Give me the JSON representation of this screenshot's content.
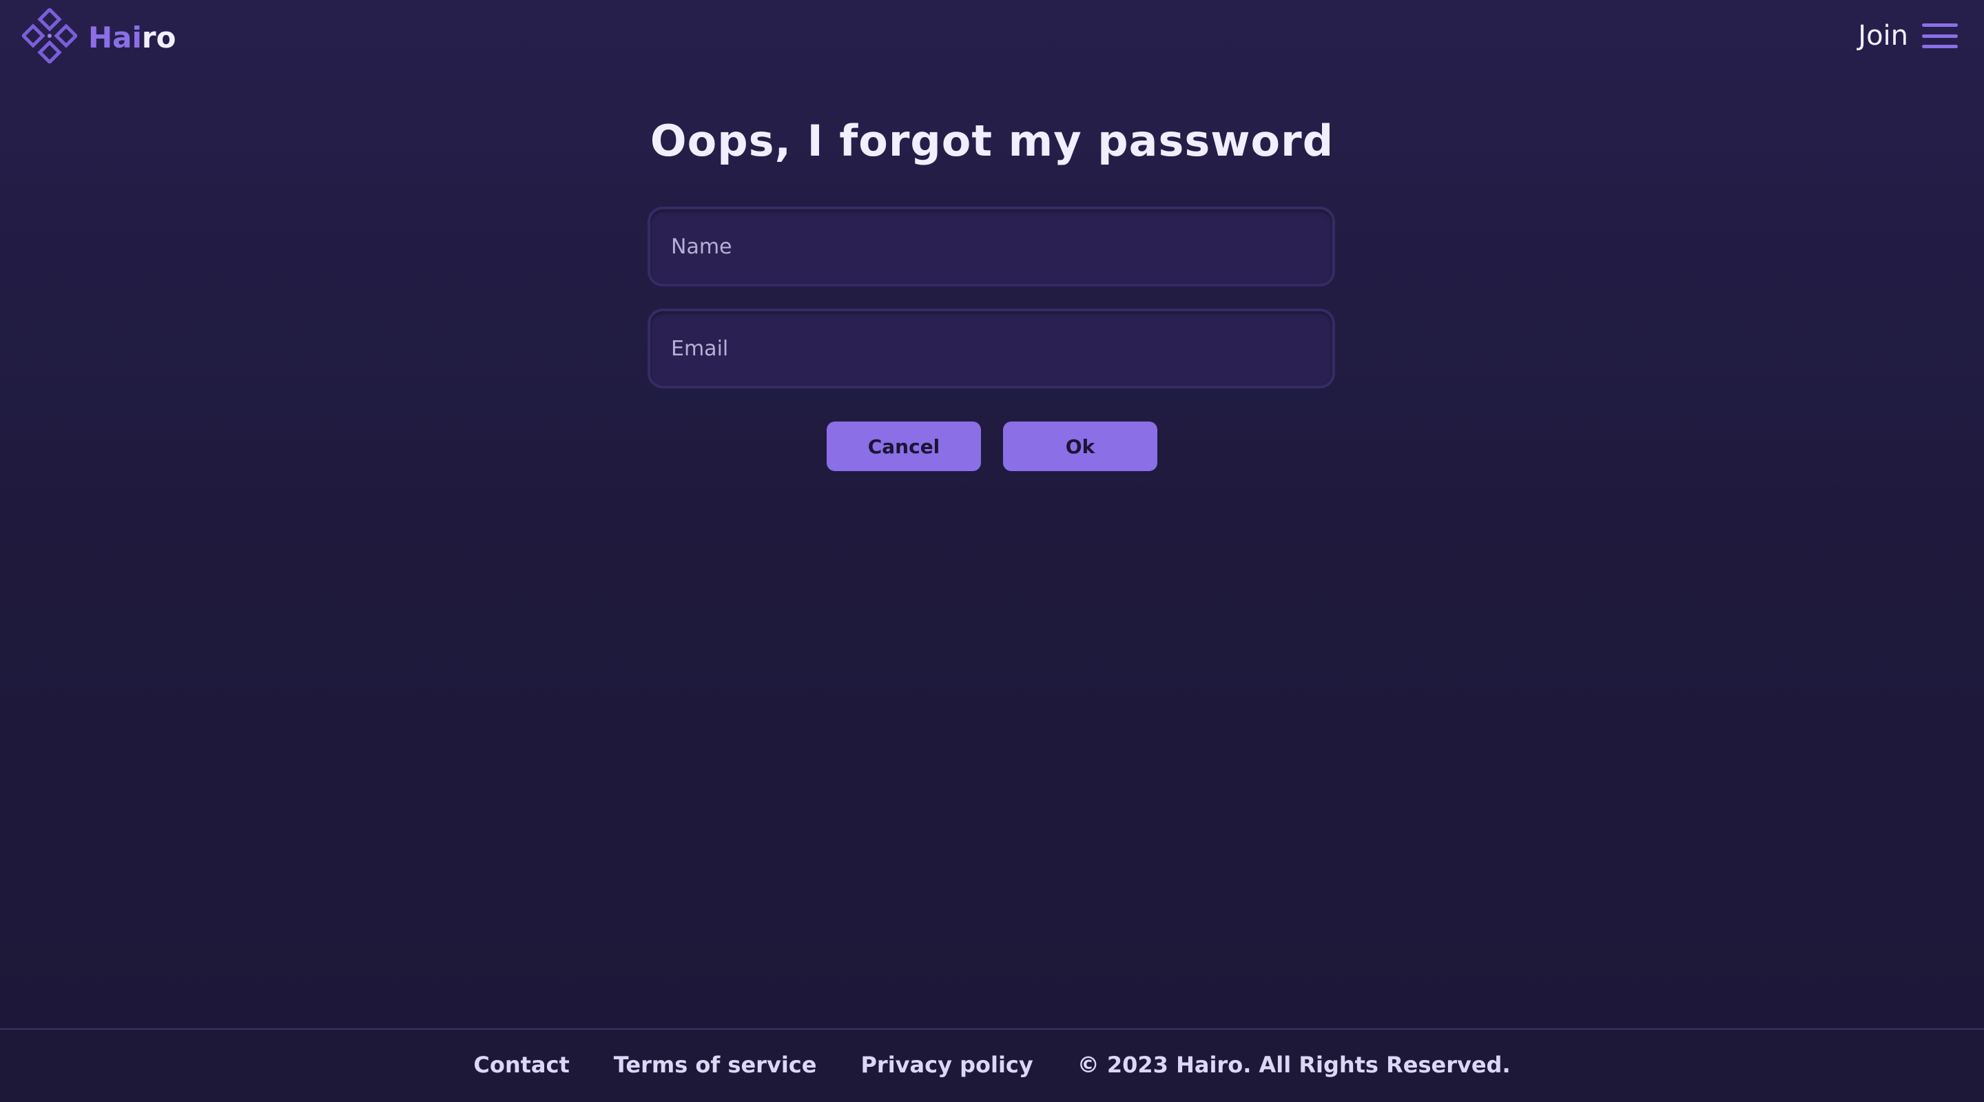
{
  "header": {
    "brand_accent": "Hai",
    "brand_rest": "ro",
    "join_label": "Join",
    "logo_icon": "diamond-cluster-icon",
    "menu_icon": "hamburger-menu-icon"
  },
  "main": {
    "title": "Oops, I forgot my password",
    "name_placeholder": "Name",
    "email_placeholder": "Email",
    "cancel_label": "Cancel",
    "ok_label": "Ok"
  },
  "footer": {
    "contact": "Contact",
    "terms": "Terms of service",
    "privacy": "Privacy policy",
    "copyright": "© 2023 Hairo. All Rights Reserved."
  },
  "colors": {
    "accent": "#8b6fe6",
    "background": "#211b42",
    "field_bg": "#2a2152",
    "text": "#f1eeff"
  }
}
